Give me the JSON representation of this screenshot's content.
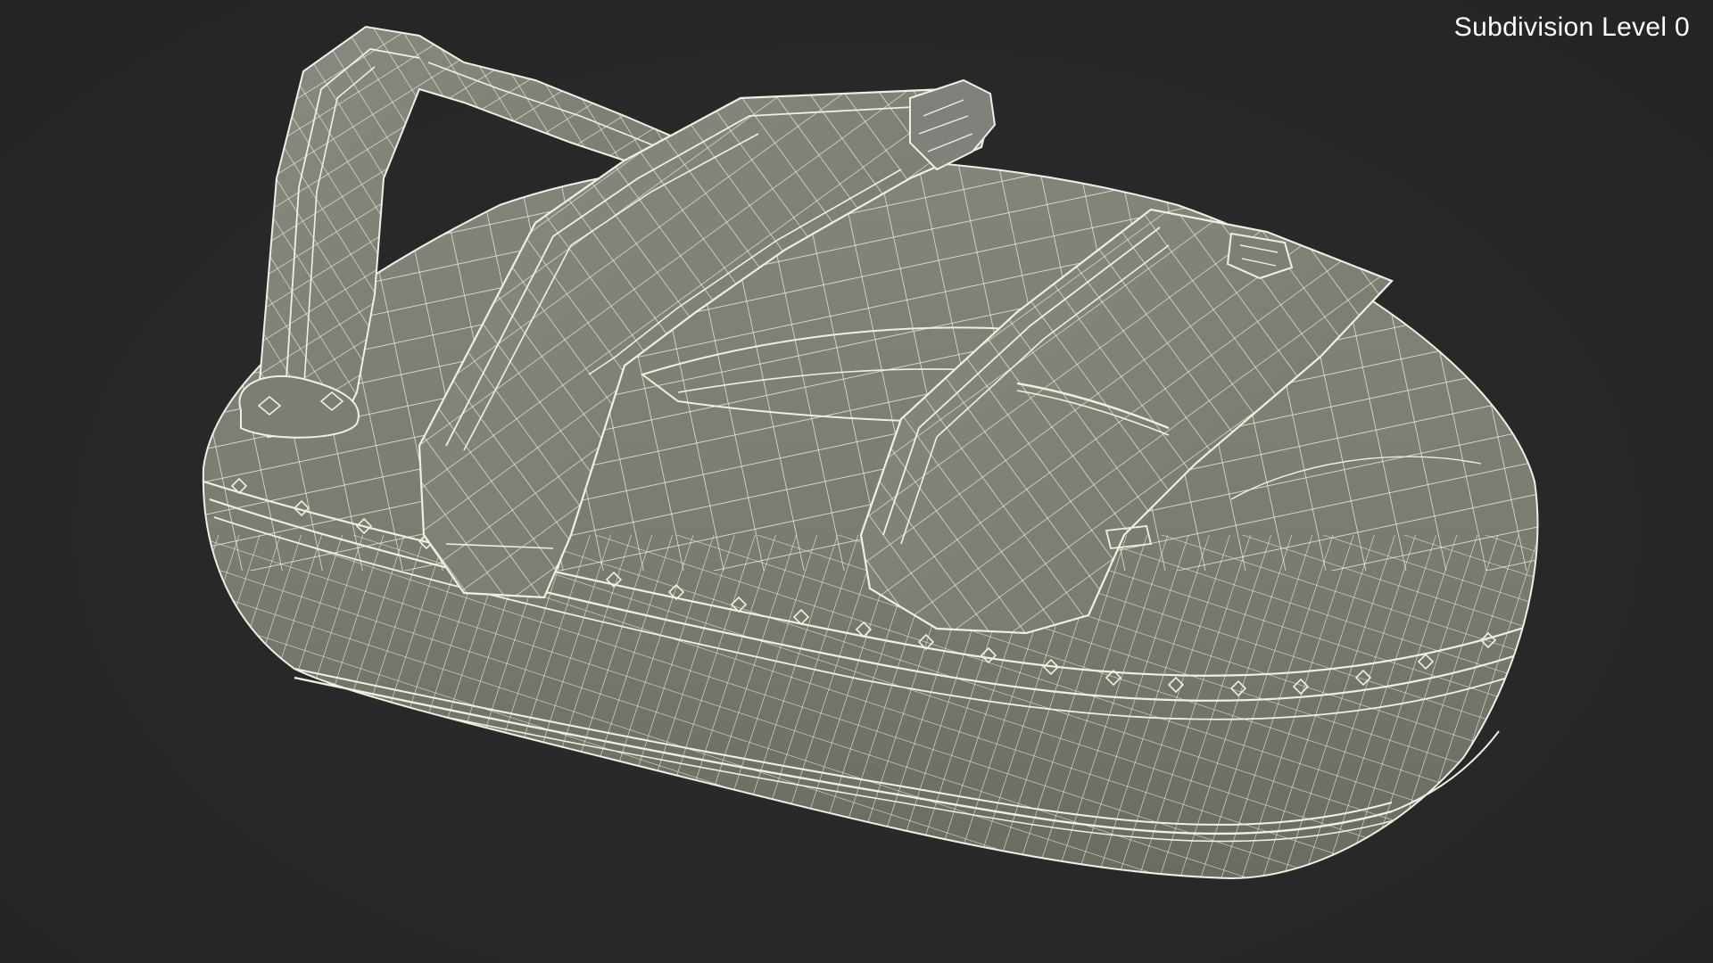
{
  "viewport": {
    "label": "Subdivision Level 0",
    "background_color": "#282828",
    "mesh_fill_color": "#7b7c72",
    "wire_color": "#f1efe2"
  }
}
